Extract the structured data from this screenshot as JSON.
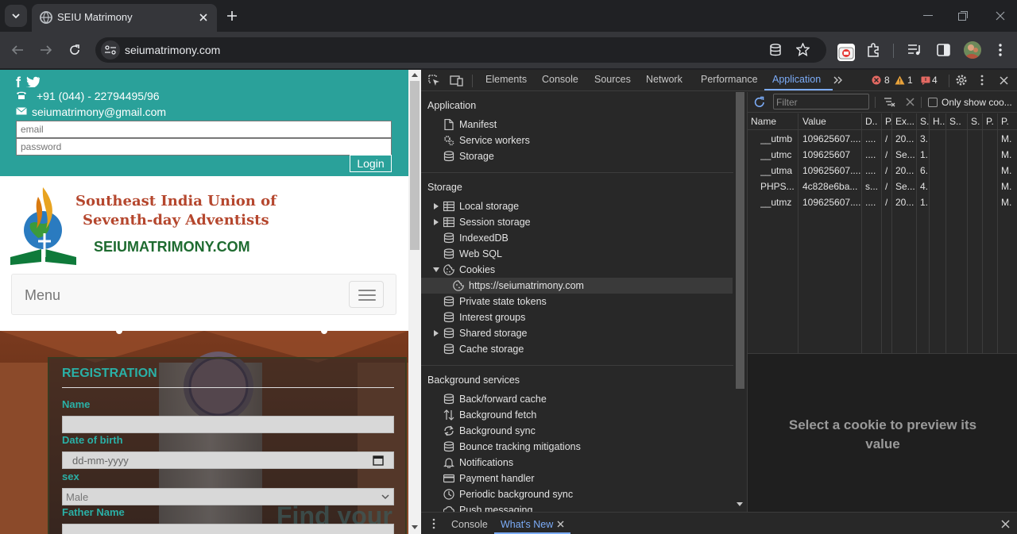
{
  "browser": {
    "tab_title": "SEIU Matrimony",
    "url": "seiumatrimony.com"
  },
  "site": {
    "phone": "+91 (044) - 22794495/96",
    "email_text": "seiumatrimony@gmail.com",
    "email_placeholder": "email",
    "password_placeholder": "password",
    "login_label": "Login",
    "logo_line1": "Southeast India Union of",
    "logo_line2": "Seventh-day Adventists",
    "logo_line3": "SEIUMATRIMONY.COM",
    "menu_label": "Menu",
    "registration_title": "REGISTRATION",
    "name_label": "Name",
    "dob_label": "Date of birth",
    "dob_placeholder": "dd-mm-yyyy",
    "sex_label": "sex",
    "sex_value": "Male",
    "father_label": "Father Name",
    "find_text": "Find your"
  },
  "devtools": {
    "tabs": [
      "Elements",
      "Console",
      "Sources",
      "Network",
      "Performance",
      "Application"
    ],
    "active_tab": "Application",
    "errors": "8",
    "warnings": "1",
    "issues": "4",
    "sections": {
      "application": {
        "title": "Application",
        "items": [
          "Manifest",
          "Service workers",
          "Storage"
        ]
      },
      "storage": {
        "title": "Storage",
        "items": [
          "Local storage",
          "Session storage",
          "IndexedDB",
          "Web SQL",
          "Cookies",
          "https://seiumatrimony.com",
          "Private state tokens",
          "Interest groups",
          "Shared storage",
          "Cache storage"
        ]
      },
      "background": {
        "title": "Background services",
        "items": [
          "Back/forward cache",
          "Background fetch",
          "Background sync",
          "Bounce tracking mitigations",
          "Notifications",
          "Payment handler",
          "Periodic background sync",
          "Push messaging"
        ]
      }
    },
    "filter_placeholder": "Filter",
    "only_show": "Only show coo...",
    "columns": [
      "Name",
      "Value",
      "D..",
      "P.",
      "Ex...",
      "S.",
      "H..",
      "S..",
      "S.",
      "P.",
      "P."
    ],
    "rows": [
      [
        "__utmb",
        "109625607....",
        "....",
        "/",
        "20...",
        "3.",
        "",
        "",
        "",
        "",
        "M."
      ],
      [
        "__utmc",
        "109625607",
        "....",
        "/",
        "Se...",
        "1.",
        "",
        "",
        "",
        "",
        "M."
      ],
      [
        "__utma",
        "109625607....",
        "....",
        "/",
        "20...",
        "6.",
        "",
        "",
        "",
        "",
        "M."
      ],
      [
        "PHPS...",
        "4c828e6ba...",
        "s...",
        "/",
        "Se...",
        "4.",
        "",
        "",
        "",
        "",
        "M."
      ],
      [
        "__utmz",
        "109625607....",
        "....",
        "/",
        "20...",
        "1.",
        "",
        "",
        "",
        "",
        "M."
      ]
    ],
    "preview_text": "Select a cookie to preview its value",
    "drawer_tabs": [
      "Console",
      "What's New"
    ],
    "drawer_active": "What's New"
  }
}
